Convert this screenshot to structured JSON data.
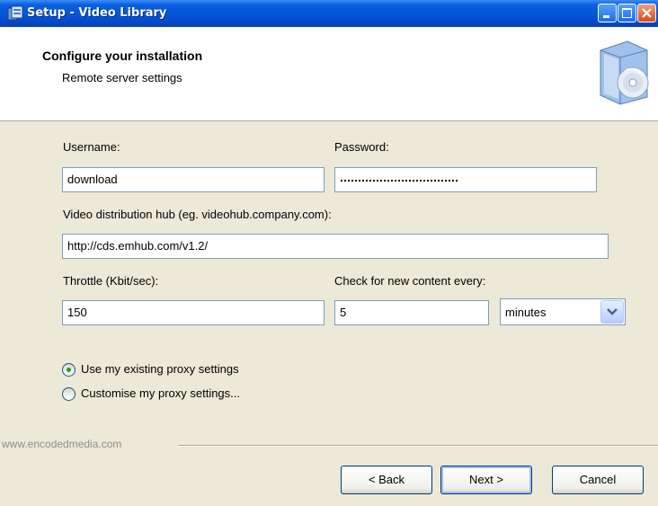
{
  "window": {
    "title": "Setup - Video Library"
  },
  "header": {
    "title": "Configure your installation",
    "subtitle": "Remote server settings"
  },
  "form": {
    "username": {
      "label": "Username:",
      "value": "download"
    },
    "password": {
      "label": "Password:",
      "masked": true
    },
    "hub": {
      "label": "Video distribution hub (eg. videohub.company.com):",
      "value": "http://cds.emhub.com/v1.2/"
    },
    "throttle": {
      "label": "Throttle (Kbit/sec):",
      "value": "150"
    },
    "check": {
      "label": "Check for new content every:",
      "value": "5",
      "unit": "minutes"
    }
  },
  "proxy": {
    "options": [
      {
        "label": "Use my existing proxy settings",
        "selected": true
      },
      {
        "label": "Customise my proxy settings...",
        "selected": false
      }
    ]
  },
  "footer": {
    "brand": "www.encodedmedia.com",
    "buttons": {
      "back": "< Back",
      "next": "Next >",
      "cancel": "Cancel"
    }
  },
  "colors": {
    "titlebar": "#0455da",
    "dialog_bg": "#ece9d8",
    "radio_selected": "#21a121"
  }
}
